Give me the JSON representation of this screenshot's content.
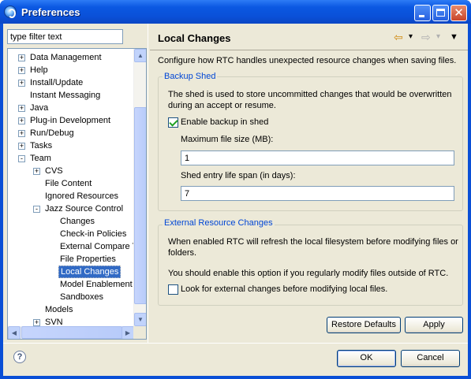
{
  "window": {
    "title": "Preferences"
  },
  "filter": {
    "value": "type filter text"
  },
  "tree": {
    "items": [
      {
        "label": "Data Management",
        "expander": "+"
      },
      {
        "label": "Help",
        "expander": "+"
      },
      {
        "label": "Install/Update",
        "expander": "+"
      },
      {
        "label": "Instant Messaging",
        "expander": ""
      },
      {
        "label": "Java",
        "expander": "+"
      },
      {
        "label": "Plug-in Development",
        "expander": "+"
      },
      {
        "label": "Run/Debug",
        "expander": "+"
      },
      {
        "label": "Tasks",
        "expander": "+"
      },
      {
        "label": "Team",
        "expander": "-"
      },
      {
        "label": "CVS",
        "expander": "+"
      },
      {
        "label": "File Content",
        "expander": ""
      },
      {
        "label": "Ignored Resources",
        "expander": ""
      },
      {
        "label": "Jazz Source Control",
        "expander": "-"
      },
      {
        "label": "Changes",
        "expander": ""
      },
      {
        "label": "Check-in Policies",
        "expander": ""
      },
      {
        "label": "External Compare T",
        "expander": ""
      },
      {
        "label": "File Properties",
        "expander": ""
      },
      {
        "label": "Local Changes",
        "expander": "",
        "selected": true
      },
      {
        "label": "Model Enablement",
        "expander": ""
      },
      {
        "label": "Sandboxes",
        "expander": ""
      },
      {
        "label": "Models",
        "expander": ""
      },
      {
        "label": "SVN",
        "expander": "+"
      }
    ]
  },
  "page": {
    "title": "Local Changes",
    "description": "Configure how RTC handles unexpected resource changes when saving files."
  },
  "nav": {
    "back_glyph": "⇦",
    "back_dropdown_glyph": "▾",
    "forward_glyph": "⇨",
    "forward_dropdown_glyph": "▾",
    "menu_glyph": "▼"
  },
  "backup_shed": {
    "title": "Backup Shed",
    "description_line1": "The shed is used to store uncommitted changes that would be overwritten",
    "description_line2": "during an accept or resume.",
    "enable_label": "Enable backup in shed",
    "enable_checked": true,
    "max_size_label": "Maximum file size (MB):",
    "max_size_value": "1",
    "life_span_label": "Shed entry life span (in days):",
    "life_span_value": "7"
  },
  "external_changes": {
    "title": "External Resource Changes",
    "description_line1": "When enabled RTC will refresh the local filesystem before modifying files or",
    "description_line2": "folders.",
    "advice": "You should enable this option if you regularly modify files outside of RTC.",
    "look_label": "Look for external changes before modifying local files.",
    "look_checked": false
  },
  "buttons": {
    "restore_defaults": "Restore Defaults",
    "apply": "Apply",
    "ok": "OK",
    "cancel": "Cancel"
  },
  "help": {
    "glyph": "?"
  }
}
